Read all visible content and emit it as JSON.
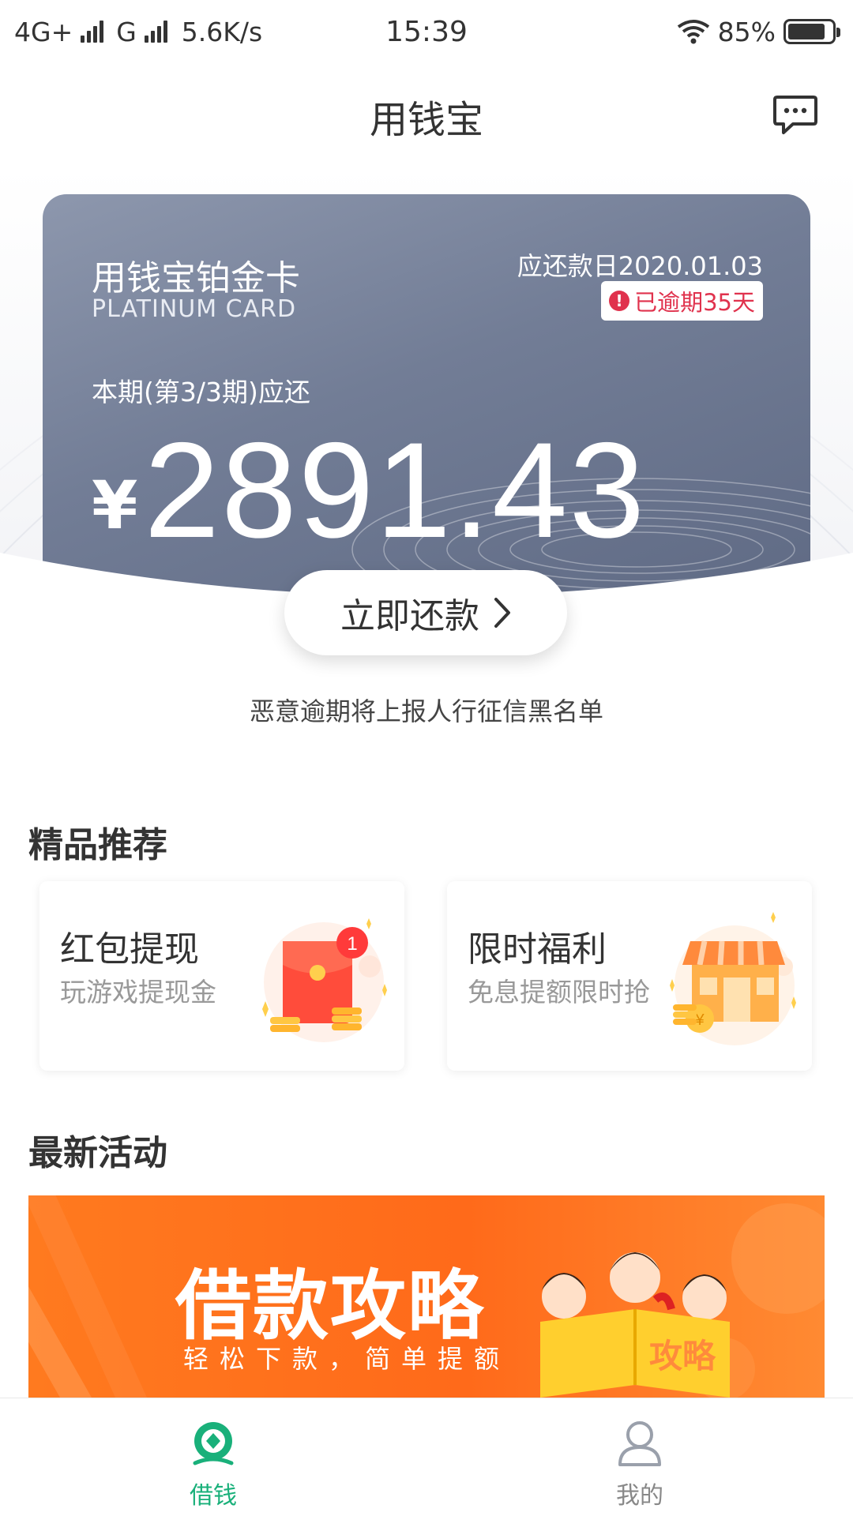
{
  "status_bar": {
    "network_left": "4G+",
    "network_right": "G",
    "speed": "5.6K/s",
    "time": "15:39",
    "battery_percent": "85%",
    "battery_level": 0.85
  },
  "header": {
    "title": "用钱宝",
    "chat_icon": "chat-bubble-icon"
  },
  "card": {
    "name": "用钱宝铂金卡",
    "subtitle": "PLATINUM CARD",
    "due_date": "应还款日2020.01.03",
    "overdue": "已逾期35天",
    "period": "本期(第3/3期)应还",
    "currency": "¥",
    "amount": "2891.43"
  },
  "repay_button": {
    "label": "立即还款",
    "icon": "chevron-right-icon"
  },
  "warning": "恶意逾期将上报人行征信黑名单",
  "recommend": {
    "title": "精品推荐",
    "items": [
      {
        "title": "红包提现",
        "subtitle": "玩游戏提现金",
        "badge": "1",
        "icon": "red-envelope-icon"
      },
      {
        "title": "限时福利",
        "subtitle": "免息提额限时抢",
        "icon": "store-icon"
      }
    ]
  },
  "activities": {
    "title": "最新活动",
    "banner_title": "借款攻略",
    "banner_subtitle": "轻松下款，简单提额",
    "banner_book_text": "攻略"
  },
  "tabs": [
    {
      "label": "借钱",
      "icon": "coin-icon",
      "active": true
    },
    {
      "label": "我的",
      "icon": "user-icon",
      "active": false
    }
  ],
  "colors": {
    "accent_green": "#19b07a",
    "overdue_red": "#e0324d",
    "banner_orange": "#ff6a1a",
    "card_slate": "#727d96"
  }
}
